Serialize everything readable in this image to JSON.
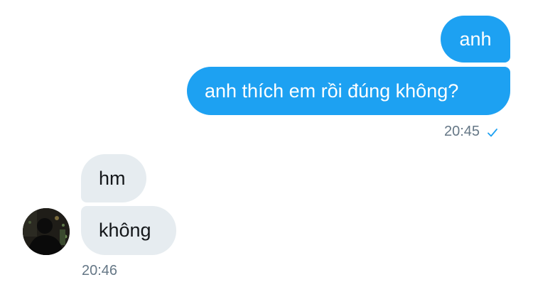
{
  "conversation": {
    "sent_group": {
      "messages": [
        "anh",
        "anh thích em rồi đúng không?"
      ],
      "time": "20:45",
      "status_icon": "checkmark-icon"
    },
    "received_group": {
      "messages": [
        "hm",
        "không"
      ],
      "time": "20:46",
      "avatar_icon": "contact-avatar"
    },
    "colors": {
      "sent_bubble": "#1da1f2",
      "received_bubble": "#e6ecf0",
      "timestamp": "#657786"
    }
  }
}
